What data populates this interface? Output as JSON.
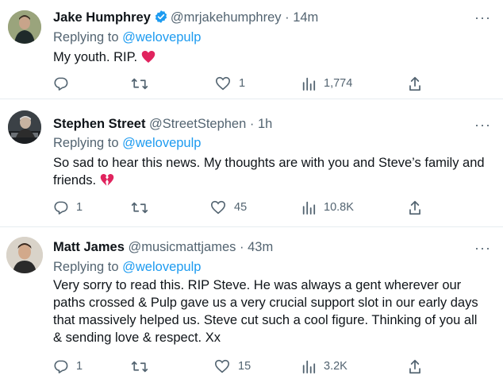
{
  "tweets": [
    {
      "name": "Jake Humphrey",
      "verified": true,
      "handle": "@mrjakehumphrey",
      "time": "· 14m",
      "replying_prefix": "Replying to ",
      "replying_to": "@welovepulp",
      "text": "My youth. RIP.",
      "emoji": "red-heart",
      "replies": "",
      "retweets": "",
      "likes": "1",
      "views": "1,774"
    },
    {
      "name": "Stephen Street",
      "verified": false,
      "handle": "@StreetStephen",
      "time": "· 1h",
      "replying_prefix": "Replying to ",
      "replying_to": "@welovepulp",
      "text_line1": "So sad to hear this news. My thoughts are with you and Steve’s family and",
      "text_line2": "friends.",
      "emoji": "broken-heart",
      "replies": "1",
      "retweets": "",
      "likes": "45",
      "views": "10.8K"
    },
    {
      "name": "Matt James",
      "verified": false,
      "handle": "@musicmattjames",
      "time": "· 43m",
      "replying_prefix": "Replying to ",
      "replying_to": "@welovepulp",
      "text_line1": "Very sorry to read this. RIP Steve. He was always a gent wherever our",
      "text_line2": "paths crossed & Pulp gave us a very crucial support slot in our early days",
      "text_line3": "that massively helped us. Steve cut such a cool figure. Thinking of you all",
      "text_line4": "& sending love & respect. Xx",
      "replies": "1",
      "retweets": "",
      "likes": "15",
      "views": "3.2K"
    }
  ],
  "more_label": "···",
  "colors": {
    "accent": "#1d9bf0",
    "muted": "#536471",
    "text": "#0f1419",
    "heart": "#e0245e"
  }
}
